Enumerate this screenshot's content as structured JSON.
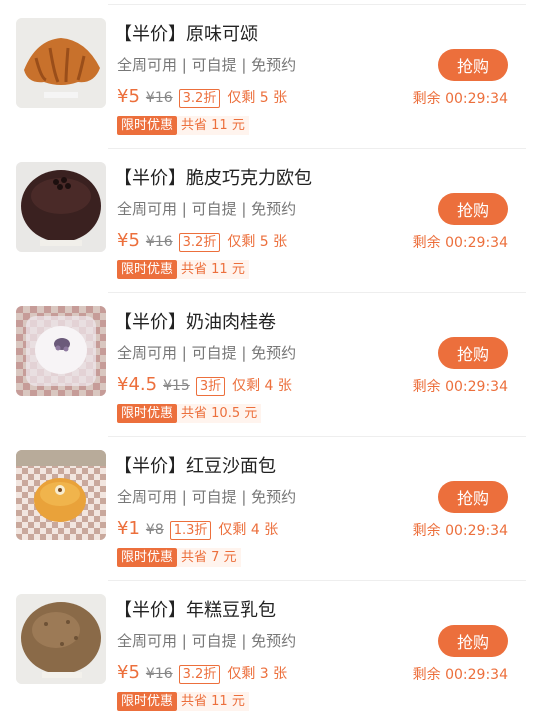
{
  "colors": {
    "accent": "#ec6f3c",
    "text_primary": "#222222",
    "text_secondary": "#777777"
  },
  "items": [
    {
      "title": "【半价】原味可颂",
      "desc": "全周可用 | 可自提 | 免预约",
      "price": "¥5",
      "orig_price": "¥16",
      "discount": "3.2折",
      "remaining": "仅剩 5 张",
      "limit_tag": "限时优惠",
      "save_tag": "共省 11 元",
      "buy_label": "抢购",
      "timer": "剩余 00:29:34",
      "image_icon": "croissant-image"
    },
    {
      "title": "【半价】脆皮巧克力欧包",
      "desc": "全周可用 | 可自提 | 免预约",
      "price": "¥5",
      "orig_price": "¥16",
      "discount": "3.2折",
      "remaining": "仅剩 5 张",
      "limit_tag": "限时优惠",
      "save_tag": "共省 11 元",
      "buy_label": "抢购",
      "timer": "剩余 00:29:34",
      "image_icon": "chocolate-bread-image"
    },
    {
      "title": "【半价】奶油肉桂卷",
      "desc": "全周可用 | 可自提 | 免预约",
      "price": "¥4.5",
      "orig_price": "¥15",
      "discount": "3折",
      "remaining": "仅剩 4 张",
      "limit_tag": "限时优惠",
      "save_tag": "共省 10.5 元",
      "buy_label": "抢购",
      "timer": "剩余 00:29:34",
      "image_icon": "cinnamon-roll-image"
    },
    {
      "title": "【半价】红豆沙面包",
      "desc": "全周可用 | 可自提 | 免预约",
      "price": "¥1",
      "orig_price": "¥8",
      "discount": "1.3折",
      "remaining": "仅剩 4 张",
      "limit_tag": "限时优惠",
      "save_tag": "共省 7 元",
      "buy_label": "抢购",
      "timer": "剩余 00:29:34",
      "image_icon": "red-bean-bun-image"
    },
    {
      "title": "【半价】年糕豆乳包",
      "desc": "全周可用 | 可自提 | 免预约",
      "price": "¥5",
      "orig_price": "¥16",
      "discount": "3.2折",
      "remaining": "仅剩 3 张",
      "limit_tag": "限时优惠",
      "save_tag": "共省 11 元",
      "buy_label": "抢购",
      "timer": "剩余 00:29:34",
      "image_icon": "rice-cake-soy-bun-image"
    }
  ]
}
